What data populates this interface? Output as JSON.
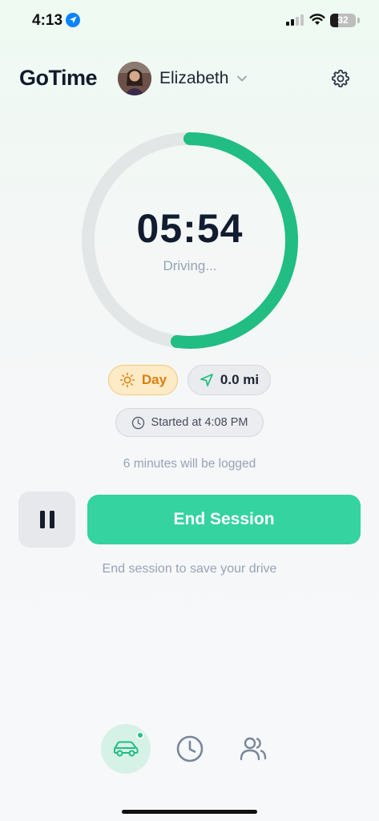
{
  "status_bar": {
    "time": "4:13",
    "battery": "32",
    "battery_level": 0.32
  },
  "header": {
    "app_title": "GoTime",
    "user_name": "Elizabeth"
  },
  "timer": {
    "elapsed": "05:54",
    "status": "Driving...",
    "progress": 0.52,
    "accent_color": "#21bd83",
    "track_color": "#e3e6e6"
  },
  "chips": {
    "period": "Day",
    "distance": "0.0 mi",
    "started": "Started at 4:08 PM"
  },
  "notes": {
    "minutes_logged": "6 minutes will be logged",
    "save_hint": "End session to save your drive"
  },
  "actions": {
    "end_session": "End Session",
    "pause_icon": "pause-icon"
  },
  "nav": {
    "items": [
      "car-icon",
      "clock-icon",
      "people-icon"
    ],
    "active": "car-icon"
  },
  "colors": {
    "accent": "#34d39f",
    "day_chip": "#fdebc6",
    "day_text": "#d97f12"
  }
}
